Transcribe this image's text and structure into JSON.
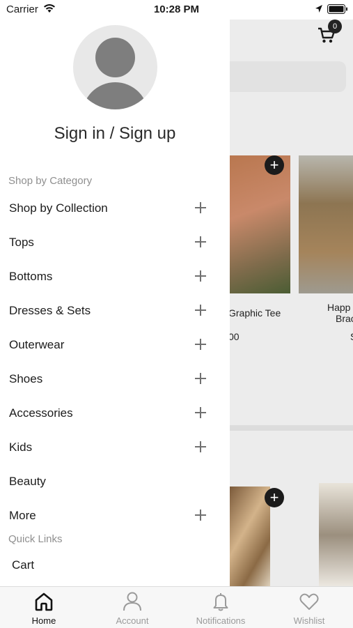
{
  "status_bar": {
    "carrier": "Carrier",
    "time": "10:28 PM"
  },
  "background": {
    "cart_count": "0",
    "products": [
      {
        "name": "Graphic Tee",
        "price": "00"
      },
      {
        "name_line1": "Happ",
        "name_line2": "Brac",
        "price": "S"
      }
    ]
  },
  "drawer": {
    "sign_in": "Sign in / Sign up",
    "shop_section": "Shop by Category",
    "items": [
      {
        "label": "Shop by Collection",
        "expandable": true
      },
      {
        "label": "Tops",
        "expandable": true
      },
      {
        "label": "Bottoms",
        "expandable": true
      },
      {
        "label": "Dresses & Sets",
        "expandable": true
      },
      {
        "label": "Outerwear",
        "expandable": true
      },
      {
        "label": "Shoes",
        "expandable": true
      },
      {
        "label": "Accessories",
        "expandable": true
      },
      {
        "label": "Kids",
        "expandable": true
      },
      {
        "label": "Beauty",
        "expandable": false
      },
      {
        "label": "More",
        "expandable": true
      }
    ],
    "quick_links_section": "Quick Links",
    "quick_links": [
      {
        "label": "Cart"
      }
    ]
  },
  "tabbar": {
    "tabs": [
      {
        "label": "Home",
        "icon": "home-icon",
        "active": true
      },
      {
        "label": "Account",
        "icon": "user-icon",
        "active": false
      },
      {
        "label": "Notifications",
        "icon": "bell-icon",
        "active": false
      },
      {
        "label": "Wishlist",
        "icon": "heart-icon",
        "active": false
      }
    ]
  },
  "colors": {
    "active_tab": "#111111",
    "inactive_tab": "#9a9a9a",
    "section_title": "#8f8f8f",
    "overlay": "#ececec"
  }
}
